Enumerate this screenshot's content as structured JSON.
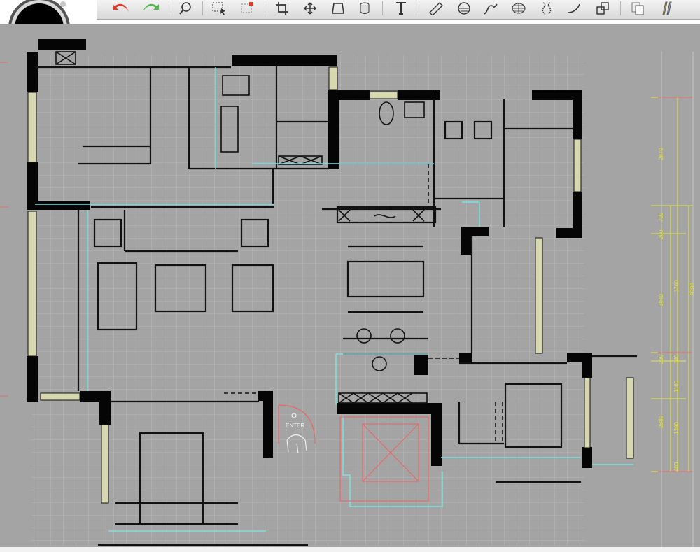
{
  "toolbar": {
    "tools": [
      {
        "name": "undo",
        "icon": "undo-arrow-icon",
        "color": "#e03a2a"
      },
      {
        "name": "redo",
        "icon": "redo-arrow-icon",
        "color": "#4fb04a"
      },
      {
        "name": "zoom",
        "icon": "magnifier-icon"
      },
      {
        "name": "select",
        "icon": "select-box-icon"
      },
      {
        "name": "crop",
        "icon": "crop-icon"
      },
      {
        "name": "move",
        "icon": "move-icon"
      },
      {
        "name": "shape",
        "icon": "shape-icon"
      },
      {
        "name": "3d-object",
        "icon": "cube-icon"
      },
      {
        "name": "text",
        "icon": "text-T-icon"
      },
      {
        "name": "ruler",
        "icon": "ruler-icon"
      },
      {
        "name": "protractor",
        "icon": "protractor-icon"
      },
      {
        "name": "pen",
        "icon": "pen-icon"
      },
      {
        "name": "grid",
        "icon": "grid-sphere-icon"
      },
      {
        "name": "curve",
        "icon": "curve-icon"
      },
      {
        "name": "arc",
        "icon": "arc-icon"
      },
      {
        "name": "shapes",
        "icon": "shapes-icon"
      },
      {
        "name": "copy",
        "icon": "copy-icon"
      },
      {
        "name": "pencil",
        "icon": "pencil-icon"
      }
    ]
  },
  "record_button": {
    "icon": "record-icon",
    "color": "#000000"
  },
  "canvas": {
    "background": "#a4a4a4",
    "enter_label": "ENTER",
    "dimensions_right": {
      "segments": [
        "2870",
        "700",
        "200",
        "3040",
        "230",
        "140",
        "1160",
        "2880",
        "1390",
        "400"
      ],
      "totals": [
        "3760",
        "9780"
      ],
      "color": "#e2e22a"
    }
  }
}
